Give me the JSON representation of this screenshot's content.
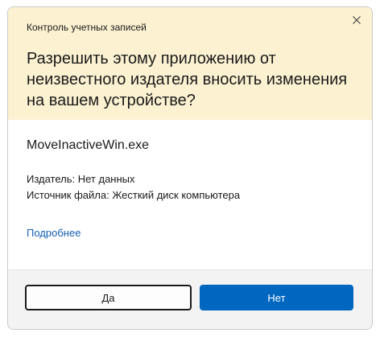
{
  "dialog": {
    "app_title": "Контроль учетных записей",
    "question": "Разрешить этому приложению от неизвестного издателя вносить изменения на вашем устройстве?",
    "program_name": "MoveInactiveWin.exe",
    "publisher": "Издатель: Нет данных",
    "origin": "Источник файла: Жесткий диск компьютера",
    "details_link": "Подробнее",
    "yes_label": "Да",
    "no_label": "Нет",
    "close_icon": "close-icon"
  },
  "colors": {
    "header_bg": "#fcf2d2",
    "footer_bg": "#f3f3f3",
    "accent": "#0067c0",
    "link": "#1560b3"
  }
}
